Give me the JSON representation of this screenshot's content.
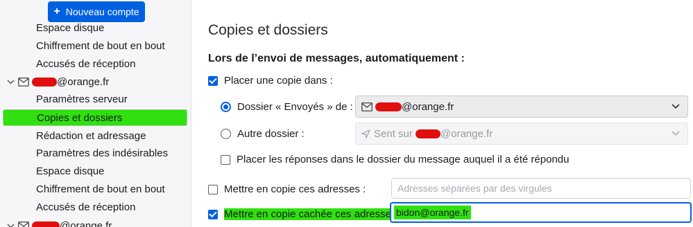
{
  "sidebar": {
    "new_account_label": "Nouveau compte",
    "items_top": [
      {
        "label": "Espace disque"
      },
      {
        "label": "Chiffrement de bout en bout"
      },
      {
        "label": "Accusés de réception"
      }
    ],
    "account": {
      "suffix": "@orange.fr"
    },
    "items_account": [
      {
        "label": "Paramètres serveur"
      },
      {
        "label": "Copies et dossiers"
      },
      {
        "label": "Rédaction et adressage"
      },
      {
        "label": "Paramètres des indésirables"
      },
      {
        "label": "Espace disque"
      },
      {
        "label": "Chiffrement de bout en bout"
      },
      {
        "label": "Accusés de réception"
      }
    ],
    "next_account": {
      "suffix": "@orange.fr"
    }
  },
  "main": {
    "title": "Copies et dossiers",
    "section_heading": "Lors de l’envoi de messages, automatiquement :",
    "place_copy": {
      "label": "Placer une copie dans :",
      "checked": true
    },
    "sent_folder": {
      "label": "Dossier « Envoyés » de :",
      "selected": true,
      "select_suffix": "@orange.fr"
    },
    "other_folder": {
      "label": "Autre dossier :",
      "selected": false,
      "select_prefix": "Sent sur",
      "select_suffix": "@orange.fr"
    },
    "replies_in_folder": {
      "label": "Placer les réponses dans le dossier du message auquel il a été répondu",
      "checked": false
    },
    "cc": {
      "label": "Mettre en copie ces adresses :",
      "checked": false,
      "placeholder": "Adresses séparées par des virgules"
    },
    "bcc": {
      "label": "Mettre en copie cachée ces adresses :",
      "checked": true,
      "value": "bidon@orange.fr"
    }
  },
  "colors": {
    "accent": "#0061e0",
    "highlight": "#30e010",
    "redaction": "#e00e0e"
  }
}
